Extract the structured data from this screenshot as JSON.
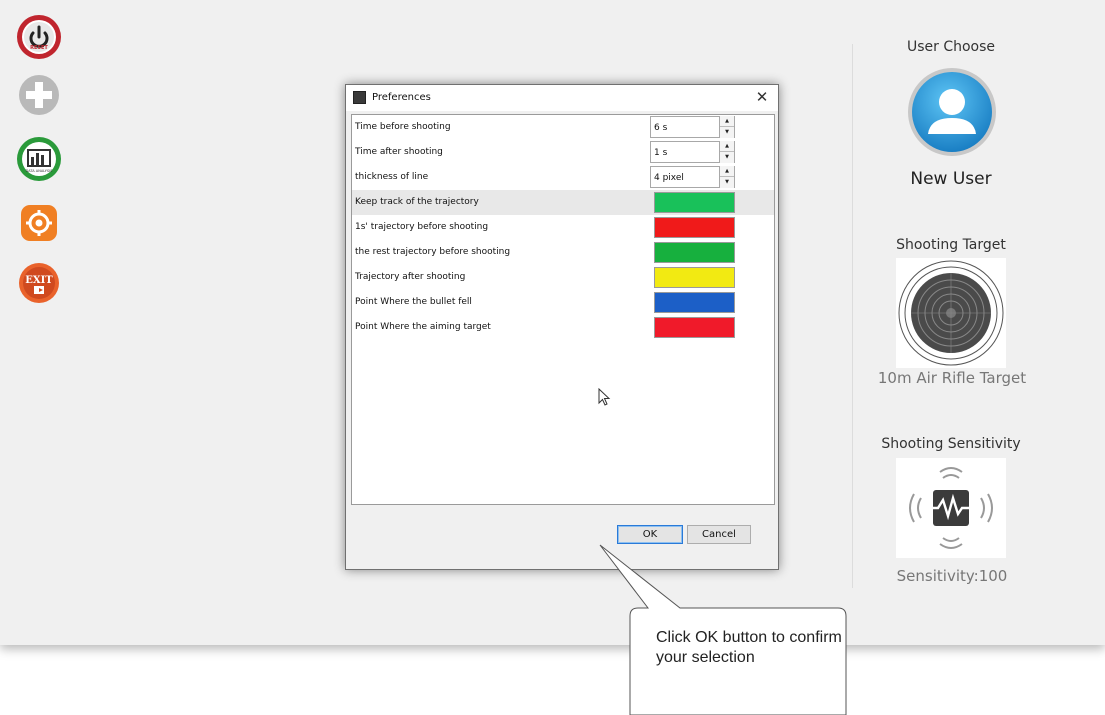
{
  "dialog": {
    "title": "Preferences",
    "close_glyph": "✕",
    "rows": [
      {
        "label": "Time before shooting",
        "type": "spin",
        "value": "6 s"
      },
      {
        "label": "Time after shooting",
        "type": "spin",
        "value": "1 s"
      },
      {
        "label": "thickness of line",
        "type": "spin",
        "value": "4 pixel"
      },
      {
        "label": "Keep track of the trajectory",
        "type": "color",
        "color": "#19c15a"
      },
      {
        "label": "1s' trajectory before shooting",
        "type": "color",
        "color": "#f01a1a"
      },
      {
        "label": "the rest trajectory before shooting",
        "type": "color",
        "color": "#17b03e"
      },
      {
        "label": "Trajectory after shooting",
        "type": "color",
        "color": "#f2ea12"
      },
      {
        "label": "Point Where the bullet fell",
        "type": "color",
        "color": "#1c5fc7"
      },
      {
        "label": "Point Where the aiming target",
        "type": "color",
        "color": "#f01a2a"
      }
    ],
    "ok_label": "OK",
    "cancel_label": "Cancel"
  },
  "side_panel": {
    "user_choose_title": "User Choose",
    "user_name": "New User",
    "target_title": "Shooting Target",
    "target_name": "10m Air Rifle Target",
    "sensitivity_title": "Shooting Sensitivity",
    "sensitivity_text": "Sensitivity:100"
  },
  "toolbar": {
    "reset_label": "RESET",
    "analysis_label": "DATA ANALYSIS",
    "exit_label": "EXIT",
    "icons": [
      "power-icon",
      "plus-icon",
      "chart-icon",
      "settings-icon",
      "exit-icon"
    ]
  },
  "callout": {
    "text": "Click OK button to confirm your selection"
  },
  "colors": {
    "reset_red": "#c0252e",
    "plus_gray": "#b9b9b9",
    "analysis_green": "#2a9a3a",
    "settings_orange": "#f07f23",
    "exit_orange": "#e9622b",
    "user_blue": "#2e9fe0",
    "ok_focus_blue": "#2a7ad8"
  }
}
